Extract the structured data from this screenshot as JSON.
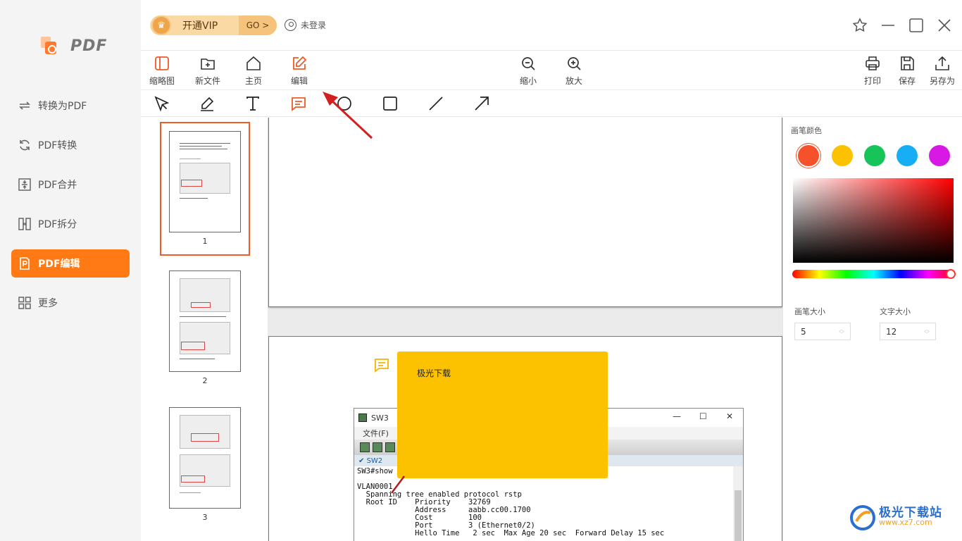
{
  "app": {
    "logo_text": "PDF"
  },
  "sidebar": {
    "items": [
      {
        "label": "转换为PDF",
        "icon": "convert-arrows-icon"
      },
      {
        "label": "PDF转换",
        "icon": "refresh-icon"
      },
      {
        "label": "PDF合并",
        "icon": "merge-icon"
      },
      {
        "label": "PDF拆分",
        "icon": "split-icon"
      },
      {
        "label": "PDF编辑",
        "icon": "edit-document-icon",
        "active": true
      },
      {
        "label": "更多",
        "icon": "grid-icon"
      }
    ]
  },
  "header": {
    "vip_label": "开通VIP",
    "vip_go": "GO >",
    "login_label": "未登录"
  },
  "toolbar": {
    "thumbnail": "缩略图",
    "new_file": "新文件",
    "home": "主页",
    "edit": "编辑",
    "zoom_out": "缩小",
    "zoom_in": "放大",
    "print": "打印",
    "save": "保存",
    "save_as": "另存为"
  },
  "draw_tools": [
    "select",
    "pen",
    "text",
    "comment",
    "circle",
    "rectangle",
    "line",
    "arrow"
  ],
  "thumbnails": {
    "pages": [
      "1",
      "2",
      "3"
    ],
    "selected": "1"
  },
  "note": {
    "text": "极光下载"
  },
  "terminal": {
    "title": "SW3",
    "menu_first": "文件(F)",
    "menu_last": ")",
    "tab": "SW2",
    "lines": [
      "SW3#show",
      "",
      "VLAN0001",
      "  Spanning tree enabled protocol rstp",
      "  Root ID    Priority    32769",
      "             Address     aabb.cc00.1700",
      "             Cost        100",
      "             Port        3 (Ethernet0/2)",
      "             Hello Time   2 sec  Max Age 20 sec  Forward Delay 15 sec"
    ]
  },
  "panel": {
    "pen_color_label": "画笔颜色",
    "colors": [
      "#f5512a",
      "#fcc200",
      "#16c45a",
      "#18aef5",
      "#d819e6"
    ],
    "selected_color": "#f5512a",
    "pen_size_label": "画笔大小",
    "pen_size": "5",
    "text_size_label": "文字大小",
    "text_size": "12"
  },
  "watermark": {
    "name": "极光下载站",
    "url": "www.xz7.com"
  }
}
